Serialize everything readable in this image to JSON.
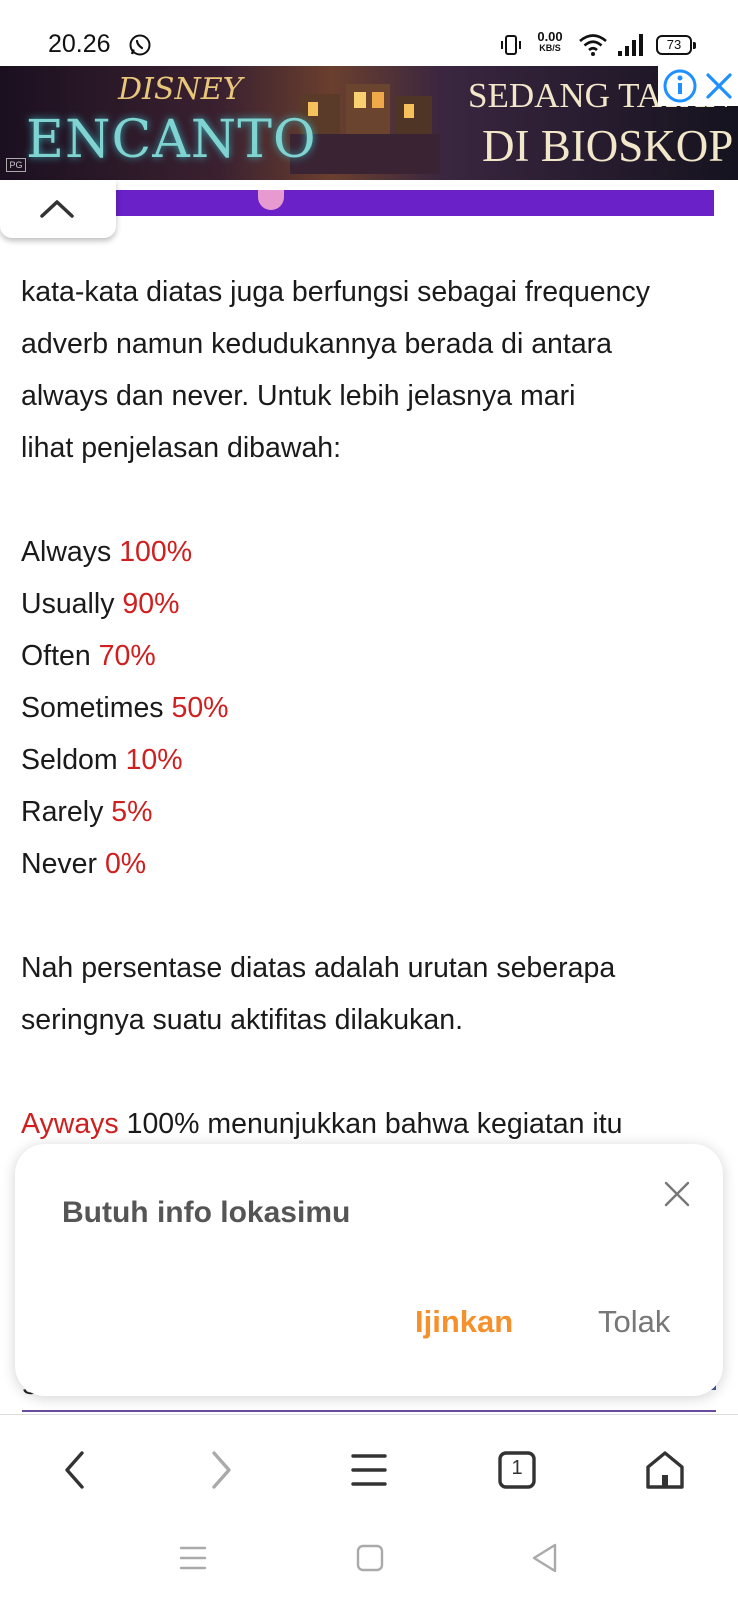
{
  "status_bar": {
    "time": "20.26",
    "net_speed_value": "0.00",
    "net_speed_unit": "KB/S",
    "battery": "73",
    "icons": [
      "whatsapp-icon",
      "vibrate-icon",
      "wifi-icon",
      "signal-icon",
      "battery-icon"
    ]
  },
  "ad": {
    "brand": "DISNEY",
    "title": "ENCANTO",
    "line1": "SEDANG TAYANG",
    "line2": "DI BIOSKOP",
    "rating": "PG",
    "colors": {
      "title": "#7fd3d0",
      "text": "#f2e7c9",
      "info": "#1e90ff"
    }
  },
  "article": {
    "intro": [
      "kata-kata diatas juga berfungsi sebagai frequency",
      "adverb namun kedudukannya berada di antara",
      "always dan never. Untuk lebih jelasnya mari",
      "lihat penjelasan dibawah:"
    ],
    "frequency_list": [
      {
        "word": "Always",
        "percent": "100%"
      },
      {
        "word": "Usually",
        "percent": "90%"
      },
      {
        "word": "Often",
        "percent": "70%"
      },
      {
        "word": "Sometimes",
        "percent": "50%"
      },
      {
        "word": "Seldom",
        "percent": "10%"
      },
      {
        "word": "Rarely",
        "percent": "5%"
      },
      {
        "word": "Never",
        "percent": "0%"
      }
    ],
    "summary": [
      "Nah persentase diatas adalah urutan seberapa",
      "seringnya suatu aktifitas dilakukan."
    ],
    "last_line_highlight": "Ayways",
    "last_line_rest": " 100% menunjukkan bahwa kegiatan itu",
    "peek_char": "S",
    "accent_color": "#d01f1f"
  },
  "permission": {
    "title": "Butuh info lokasimu",
    "allow": "Ijinkan",
    "deny": "Tolak",
    "colors": {
      "allow": "#f5902a"
    }
  },
  "browser_bar": {
    "tab_count": "1",
    "icons": [
      "back-icon",
      "forward-icon",
      "menu-icon",
      "tabs-icon",
      "home-icon"
    ]
  },
  "system_nav": {
    "icons": [
      "recents-icon",
      "home-square-icon",
      "back-triangle-icon"
    ]
  }
}
